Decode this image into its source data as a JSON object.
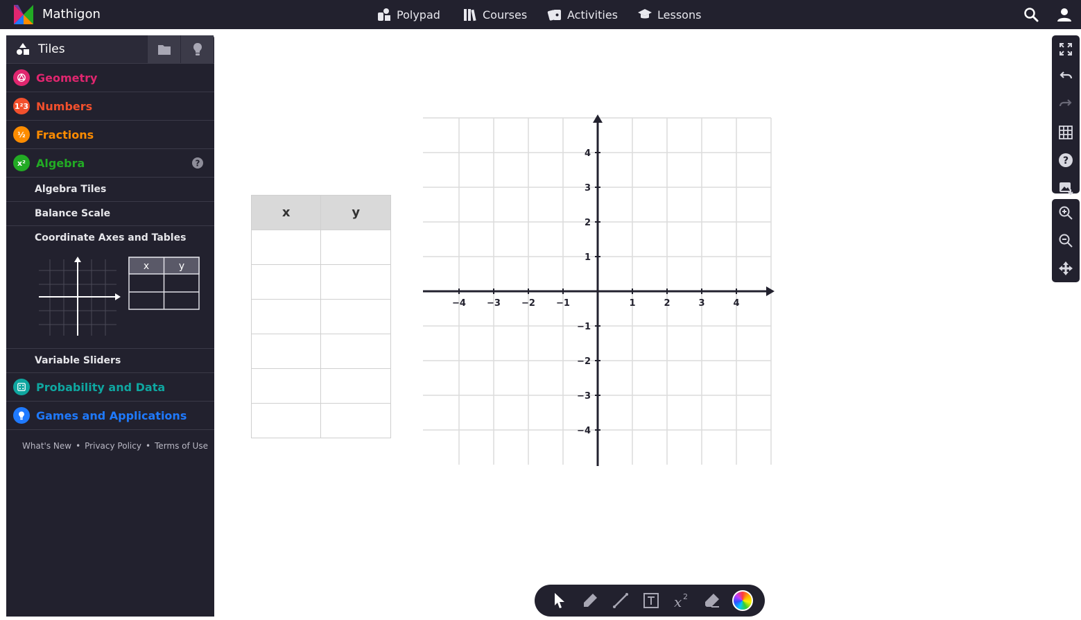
{
  "app": {
    "brand": "Mathigon"
  },
  "nav": [
    {
      "label": "Polypad",
      "icon": "polypad-icon"
    },
    {
      "label": "Courses",
      "icon": "books-icon"
    },
    {
      "label": "Activities",
      "icon": "cards-icon"
    },
    {
      "label": "Lessons",
      "icon": "graduation-cap-icon"
    }
  ],
  "sidebar": {
    "tab_label": "Tiles",
    "categories": [
      {
        "label": "Geometry",
        "color": "#e0266f",
        "icon_text": ""
      },
      {
        "label": "Numbers",
        "color": "#f2502d",
        "icon_text": "1²3"
      },
      {
        "label": "Fractions",
        "color": "#fd8c00",
        "icon_text": "½"
      },
      {
        "label": "Algebra",
        "color": "#22ab24",
        "icon_text": "x²"
      },
      {
        "label": "Probability and Data",
        "color": "#0fa6a0",
        "icon_text": ""
      },
      {
        "label": "Games and Applications",
        "color": "#1f7aff",
        "icon_text": ""
      }
    ],
    "algebra_items": [
      "Algebra Tiles",
      "Balance Scale",
      "Coordinate Axes and Tables",
      "Variable Sliders"
    ],
    "preview_table": {
      "x": "x",
      "y": "y"
    },
    "footer": [
      "What's New",
      "Privacy Policy",
      "Terms of Use"
    ],
    "footer_sep": "•"
  },
  "canvas": {
    "table": {
      "col_x": "x",
      "col_y": "y",
      "rows": 6
    },
    "axes": {
      "x_ticks": [
        "−4",
        "−3",
        "−2",
        "−1",
        "1",
        "2",
        "3",
        "4"
      ],
      "y_ticks_pos": [
        "4",
        "3",
        "2",
        "1"
      ],
      "y_ticks_neg": [
        "−1",
        "−2",
        "−3",
        "−4"
      ]
    }
  },
  "colors": {
    "dark": "#22212e",
    "grid": "#dcdcdc",
    "axis": "#22212e"
  }
}
